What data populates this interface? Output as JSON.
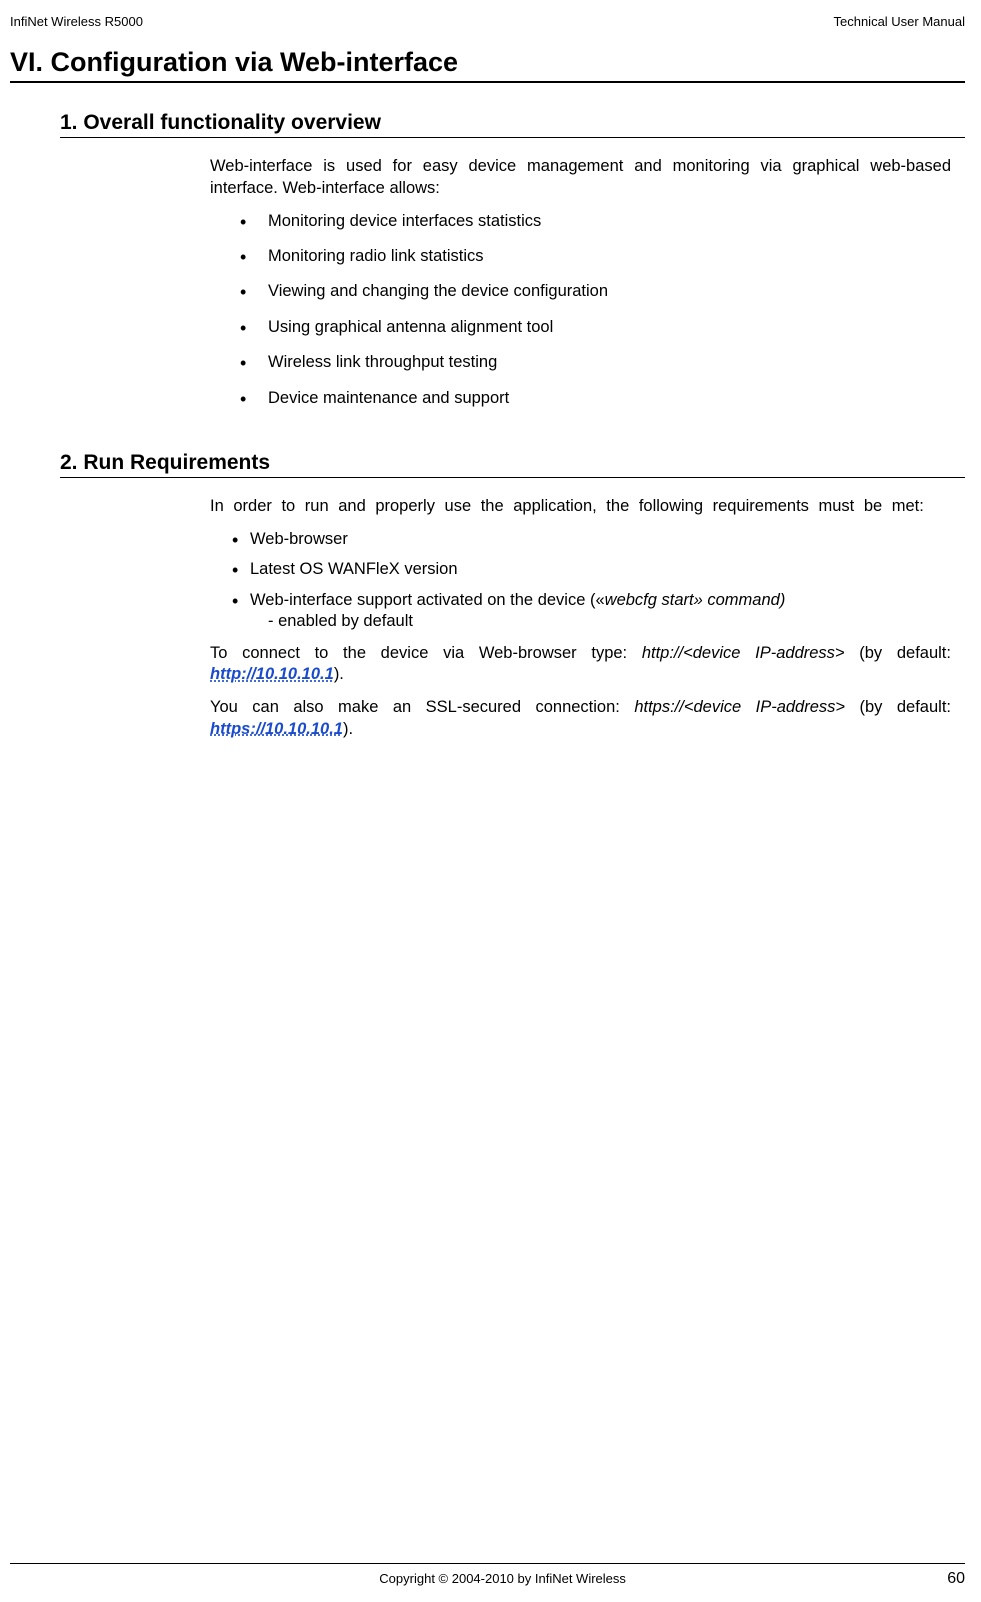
{
  "header": {
    "left": "InfiNet Wireless R5000",
    "right": "Technical User Manual"
  },
  "main_title": "VI. Configuration via Web-interface",
  "section1": {
    "title": "1. Overall functionality overview",
    "intro": "Web-interface is used for easy device management and monitoring via graphical web-based interface. Web-interface allows:",
    "items": [
      "Monitoring device interfaces statistics",
      "Monitoring radio link statistics",
      "Viewing and changing the device configuration",
      "Using graphical antenna alignment tool",
      "Wireless link throughput testing",
      "Device maintenance and support"
    ]
  },
  "section2": {
    "title": "2. Run Requirements",
    "intro": "In order to run and properly use the application, the following requirements must be met:",
    "items": {
      "i0": "Web-browser",
      "i1": "Latest OS WANFleX version",
      "i2_prefix": "Web-interface support activated on the device («",
      "i2_ital": "webcfg start» command)",
      "i2_sub": "- enabled by default"
    },
    "p1_a": "To connect to the device via Web-browser type: ",
    "p1_ital": "http://<device IP-address>",
    "p1_b": " (by default: ",
    "p1_link": "http://10.10.10.1",
    "p1_c": ").",
    "p2_a": "You can also make an SSL-secured connection: ",
    "p2_ital": "https://<device IP-address>",
    "p2_b": " (by default: ",
    "p2_link": "https://10.10.10.1",
    "p2_c": ")."
  },
  "footer": {
    "copyright": "Copyright © 2004-2010 by InfiNet Wireless",
    "page": "60"
  }
}
